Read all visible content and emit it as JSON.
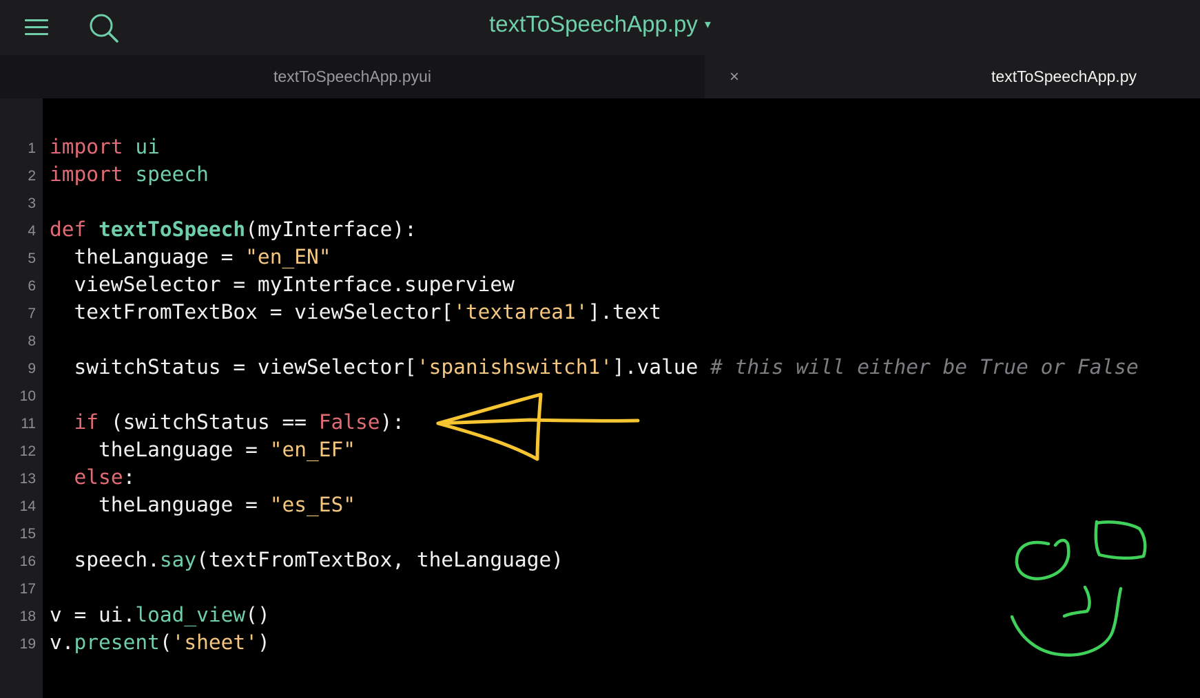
{
  "header": {
    "title": "textToSpeechApp.py",
    "title_caret": "▾",
    "menu_icon": "hamburger-menu-icon",
    "search_icon": "search-icon"
  },
  "tabs": [
    {
      "label": "textToSpeechApp.pyui",
      "active": false
    },
    {
      "label": "textToSpeechApp.py",
      "active": true,
      "close": "×"
    }
  ],
  "colors": {
    "accent": "#6fcfa9",
    "keyword": "#e06b75",
    "string": "#f5c77e",
    "comment": "#7d7d82",
    "arrow_annotation": "#f7c531",
    "face_annotation": "#3fd15a"
  },
  "code": {
    "lines": [
      {
        "n": "1",
        "t": {
          "a": "import",
          "b": " ",
          "c": "ui"
        }
      },
      {
        "n": "2",
        "t": {
          "a": "import",
          "b": " ",
          "c": "speech"
        }
      },
      {
        "n": "3"
      },
      {
        "n": "4",
        "t": {
          "a": "def",
          "b": " ",
          "c": "textToSpeech",
          "d": "(myInterface):"
        }
      },
      {
        "n": "5",
        "t": {
          "a": "  theLanguage = ",
          "b": "\"en_EN\""
        }
      },
      {
        "n": "6",
        "t": {
          "a": "  viewSelector = myInterface.superview"
        }
      },
      {
        "n": "7",
        "t": {
          "a": "  textFromTextBox = viewSelector[",
          "b": "'textarea1'",
          "c": "].text"
        }
      },
      {
        "n": "8"
      },
      {
        "n": "9",
        "t": {
          "a": "  switchStatus = viewSelector[",
          "b": "'spanishswitch1'",
          "c": "].value ",
          "d": "# this will either be True or False"
        }
      },
      {
        "n": "10"
      },
      {
        "n": "11",
        "t": {
          "a": "  ",
          "b": "if",
          "c": " (switchStatus == ",
          "d": "False",
          "e": "):"
        }
      },
      {
        "n": "12",
        "t": {
          "a": "    theLanguage = ",
          "b": "\"en_EF\""
        }
      },
      {
        "n": "13",
        "t": {
          "a": "  ",
          "b": "else",
          "c": ":"
        }
      },
      {
        "n": "14",
        "t": {
          "a": "    theLanguage = ",
          "b": "\"es_ES\""
        }
      },
      {
        "n": "15"
      },
      {
        "n": "16",
        "t": {
          "a": "  speech.",
          "b": "say",
          "c": "(textFromTextBox, theLanguage)"
        }
      },
      {
        "n": "17"
      },
      {
        "n": "18",
        "t": {
          "a": "v = ui.",
          "b": "load_view",
          "c": "()"
        }
      },
      {
        "n": "19",
        "t": {
          "a": "v.",
          "b": "present",
          "c": "(",
          "d": "'sheet'",
          "e": ")"
        }
      }
    ]
  }
}
